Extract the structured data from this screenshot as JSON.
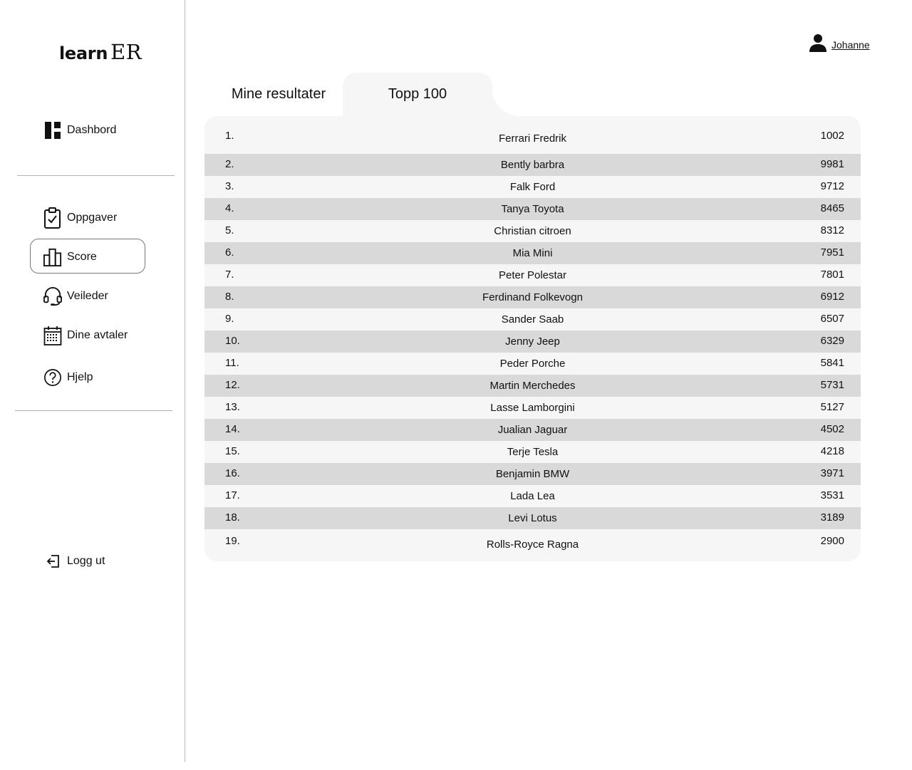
{
  "app": {
    "logo_left": "learn",
    "logo_right": "ER"
  },
  "sidebar": {
    "items": [
      {
        "label": "Dashbord",
        "icon": "dashboard-icon"
      },
      {
        "label": "Oppgaver",
        "icon": "clipboard-check-icon"
      },
      {
        "label": "Score",
        "icon": "bar-chart-icon"
      },
      {
        "label": "Veileder",
        "icon": "headset-icon"
      },
      {
        "label": "Dine avtaler",
        "icon": "calendar-icon"
      },
      {
        "label": "Hjelp",
        "icon": "help-icon"
      }
    ],
    "logout_label": "Logg ut",
    "active": "Score"
  },
  "header": {
    "user_name": "Johanne"
  },
  "tabs": [
    {
      "label": "Mine resultater",
      "active": false
    },
    {
      "label": "Topp 100",
      "active": true
    }
  ],
  "leaderboard": {
    "rows": [
      {
        "rank": "1.",
        "name": "Ferrari Fredrik",
        "score": "1002"
      },
      {
        "rank": "2.",
        "name": "Bently barbra",
        "score": "9981"
      },
      {
        "rank": "3.",
        "name": "Falk Ford",
        "score": "9712"
      },
      {
        "rank": "4.",
        "name": "Tanya Toyota",
        "score": "8465"
      },
      {
        "rank": "5.",
        "name": "Christian citroen",
        "score": "8312"
      },
      {
        "rank": "6.",
        "name": "Mia Mini",
        "score": "7951"
      },
      {
        "rank": "7.",
        "name": "Peter Polestar",
        "score": "7801"
      },
      {
        "rank": "8.",
        "name": "Ferdinand Folkevogn",
        "score": "6912"
      },
      {
        "rank": "9.",
        "name": "Sander Saab",
        "score": "6507"
      },
      {
        "rank": "10.",
        "name": "Jenny Jeep",
        "score": "6329"
      },
      {
        "rank": "11.",
        "name": "Peder Porche",
        "score": "5841"
      },
      {
        "rank": "12.",
        "name": "Martin Merchedes",
        "score": "5731"
      },
      {
        "rank": "13.",
        "name": "Lasse Lamborgini",
        "score": "5127"
      },
      {
        "rank": "14.",
        "name": "Jualian Jaguar",
        "score": "4502"
      },
      {
        "rank": "15.",
        "name": "Terje Tesla",
        "score": "4218"
      },
      {
        "rank": "16.",
        "name": "Benjamin BMW",
        "score": "3971"
      },
      {
        "rank": "17.",
        "name": "Lada Lea",
        "score": "3531"
      },
      {
        "rank": "18.",
        "name": "Levi Lotus",
        "score": "3189"
      },
      {
        "rank": "19.",
        "name": "Rolls-Royce Ragna",
        "score": "2900"
      }
    ]
  }
}
